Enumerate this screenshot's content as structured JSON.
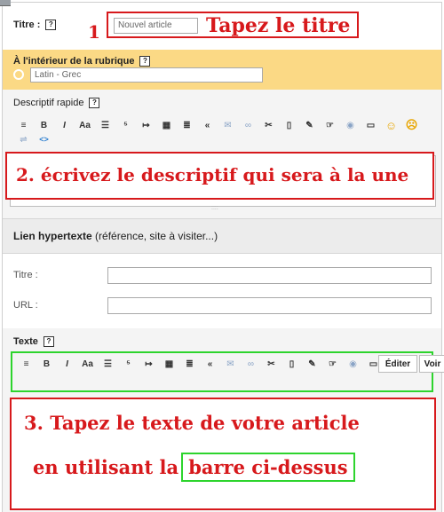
{
  "title_section": {
    "label": "Titre :",
    "help": "?",
    "value": "Nouvel article",
    "annotation": "Tapez le titre",
    "step_number": "1"
  },
  "rubrique_section": {
    "label": "À l'intérieur de la rubrique",
    "help": "?",
    "value": "Latin - Grec"
  },
  "descriptif_section": {
    "label": "Descriptif rapide",
    "help": "?",
    "annotation": "2. écrivez le descriptif qui sera à la une",
    "resize_handle": "::::"
  },
  "lien_section": {
    "header_bold": "Lien hypertexte",
    "header_note": "(référence, site à visiter...)",
    "titre_label": "Titre :",
    "url_label": "URL :"
  },
  "texte_section": {
    "label": "Texte",
    "help": "?",
    "edit_tab": "Éditer",
    "view_tab": "Voir",
    "annotation_line1": "3. Tapez le texte de votre article",
    "annotation_line2_prefix": "en utilisant la",
    "annotation_line2_boxed": "barre ci-dessus"
  },
  "toolbar": {
    "buttons": [
      "≡",
      "B",
      "I",
      "Aa",
      "☰",
      "⁵",
      "↦",
      "▦",
      "≣",
      "«",
      "✉",
      "∞",
      "✂",
      "▯",
      "✎",
      "☞",
      "◉",
      "▭",
      "☺",
      "☹",
      "⇌"
    ],
    "code_icon": "<>"
  }
}
